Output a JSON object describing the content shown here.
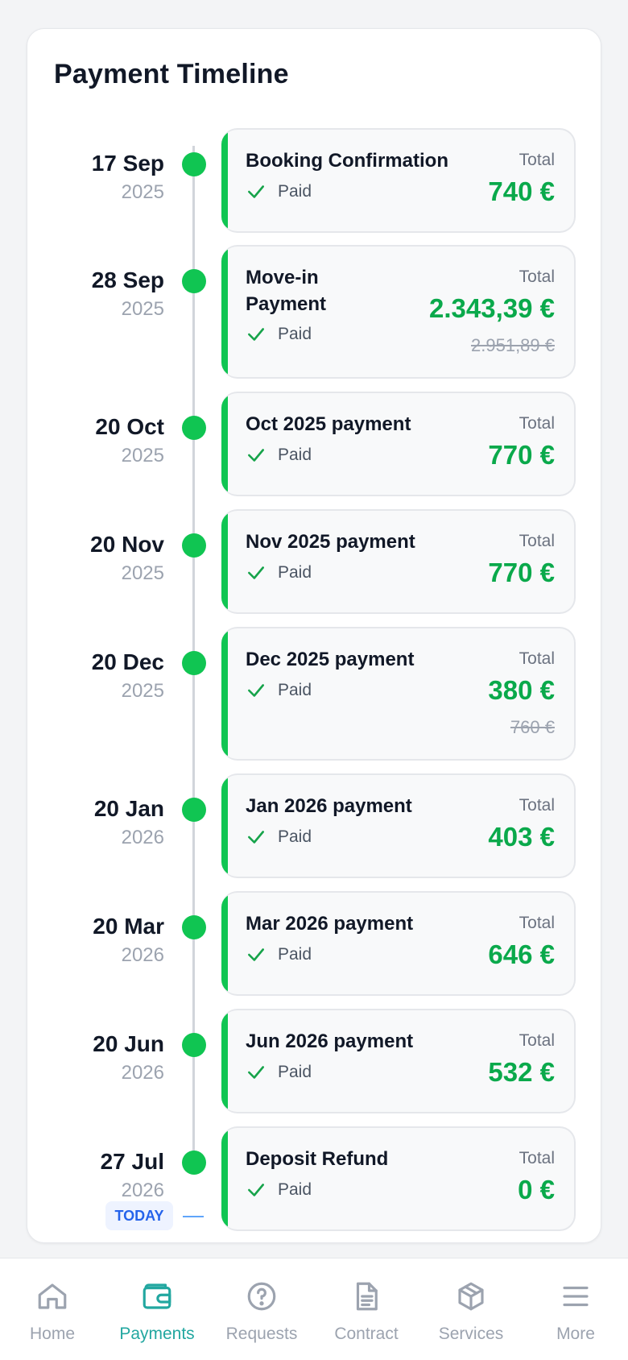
{
  "title": "Payment Timeline",
  "today_label": "TODAY",
  "total_label": "Total",
  "status_paid": "Paid",
  "entries": [
    {
      "day": "17 Sep",
      "year": "2025",
      "name": "Booking Confirmation",
      "status": "Paid",
      "total_label": "Total",
      "amount": "740 €",
      "original": ""
    },
    {
      "day": "28 Sep",
      "year": "2025",
      "name": "Move-in Payment",
      "status": "Paid",
      "total_label": "Total",
      "amount": "2.343,39 €",
      "original": "2.951,89 €"
    },
    {
      "day": "20 Oct",
      "year": "2025",
      "name": "Oct 2025 payment",
      "status": "Paid",
      "total_label": "Total",
      "amount": "770 €",
      "original": ""
    },
    {
      "day": "20 Nov",
      "year": "2025",
      "name": "Nov 2025 payment",
      "status": "Paid",
      "total_label": "Total",
      "amount": "770 €",
      "original": ""
    },
    {
      "day": "20 Dec",
      "year": "2025",
      "name": "Dec 2025 payment",
      "status": "Paid",
      "total_label": "Total",
      "amount": "380 €",
      "original": "760 €"
    },
    {
      "day": "20 Jan",
      "year": "2026",
      "name": "Jan 2026 payment",
      "status": "Paid",
      "total_label": "Total",
      "amount": "403 €",
      "original": ""
    },
    {
      "day": "20 Mar",
      "year": "2026",
      "name": "Mar 2026 payment",
      "status": "Paid",
      "total_label": "Total",
      "amount": "646 €",
      "original": ""
    },
    {
      "day": "20 Jun",
      "year": "2026",
      "name": "Jun 2026 payment",
      "status": "Paid",
      "total_label": "Total",
      "amount": "532 €",
      "original": ""
    },
    {
      "day": "27 Jul",
      "year": "2026",
      "name": "Deposit Refund",
      "status": "Paid",
      "total_label": "Total",
      "amount": "0 €",
      "original": ""
    }
  ],
  "colors": {
    "accent_green": "#10c552",
    "amount_green": "#0aa94b",
    "active_nav": "#22a7a0",
    "today_blue": "#2563eb"
  },
  "nav": [
    {
      "label": "Home",
      "icon": "home-icon",
      "active": false
    },
    {
      "label": "Payments",
      "icon": "wallet-icon",
      "active": true
    },
    {
      "label": "Requests",
      "icon": "question-circle-icon",
      "active": false
    },
    {
      "label": "Contract",
      "icon": "document-icon",
      "active": false
    },
    {
      "label": "Services",
      "icon": "box-icon",
      "active": false
    },
    {
      "label": "More",
      "icon": "menu-icon",
      "active": false
    }
  ]
}
